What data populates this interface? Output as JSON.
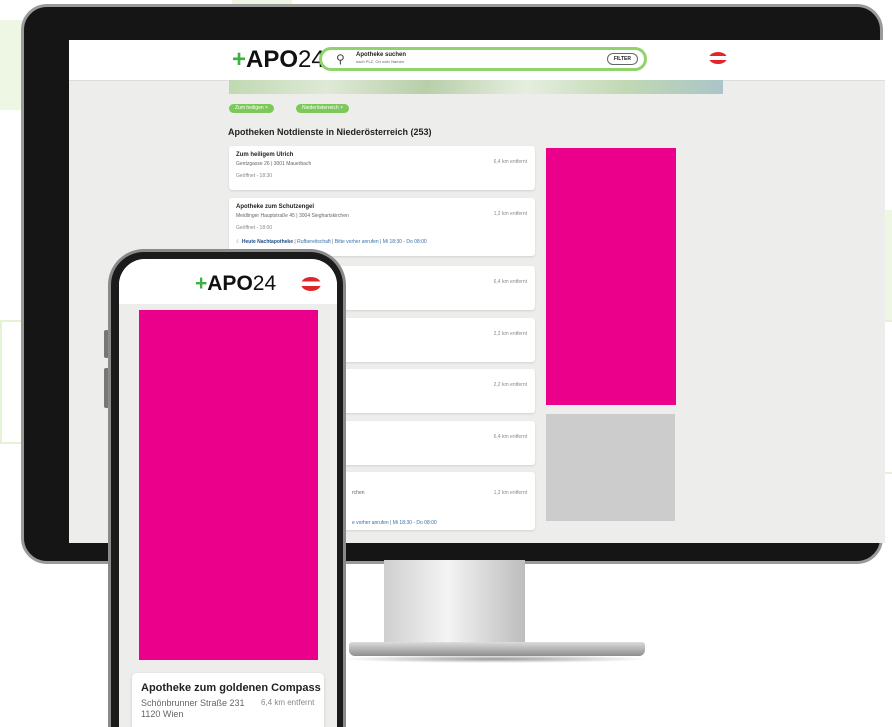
{
  "brand": {
    "logo_plus": "+",
    "logo_apo": "APO",
    "logo_num": "24"
  },
  "colors": {
    "accent_green": "#3cb043",
    "chip_green": "#7cc95a",
    "ad_magenta": "#ea008a",
    "link_blue": "#3a6fa8"
  },
  "desktop": {
    "search": {
      "title": "Apotheke suchen",
      "subtitle": "nach PLZ, Ort oder Namen",
      "icon": "search-icon",
      "filter_label": "FILTER"
    },
    "chips": [
      "Zum heiligen ×",
      "Niederösterreich ×"
    ],
    "title": "Apotheken Notdienste in Niederösterreich (253)",
    "cards": [
      {
        "name": "Zum heiligem Ulrich",
        "address": "Gentzgasse 26 | 3001 Mauerbach",
        "distance": "6,4 km entfernt",
        "status": "Geöffnet - 18:30"
      },
      {
        "name": "Apotheke zum Schutzengel",
        "address": "Meidlinger Hauptstraße 45 | 3004 Sieghartskirchen",
        "distance": "1,2 km entfernt",
        "status": "Geöffnet - 18:00",
        "night_label": "Heute Nachtapotheke",
        "night_info": " | Rufbereitschaft | Bitte vorher anrufen | Mi 18:30 - Do 08:00"
      },
      {
        "distance": "6,4 km entfernt"
      },
      {
        "distance": "2,2 km entfernt"
      },
      {
        "distance": "2,2 km entfernt"
      },
      {
        "distance": "6,4 km entfernt"
      },
      {
        "address_fragment": "rchen",
        "distance": "1,2 km entfernt",
        "night_fragment": "e vorher anrufen | Mi 18:30 - Do 08:00"
      }
    ]
  },
  "mobile": {
    "card": {
      "name": "Apotheke zum goldenen Compass",
      "street": "Schönbrunner Straße 231",
      "city": "1120 Wien",
      "distance": "6,4 km entfernt"
    }
  }
}
